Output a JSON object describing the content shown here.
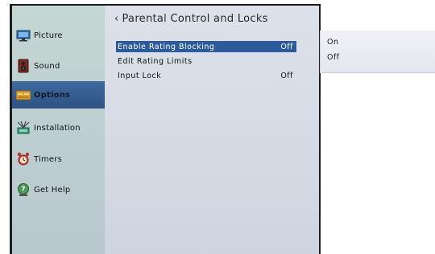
{
  "sidebar": {
    "items": [
      {
        "label": "Picture",
        "icon": "tv-icon"
      },
      {
        "label": "Sound",
        "icon": "speaker-icon"
      },
      {
        "label": "Options",
        "icon": "options-icon"
      },
      {
        "label": "Installation",
        "icon": "antenna-icon"
      },
      {
        "label": "Timers",
        "icon": "alarm-clock-icon"
      },
      {
        "label": "Get Help",
        "icon": "help-icon"
      }
    ],
    "active_index": 2
  },
  "main": {
    "back_glyph": "‹",
    "title": "Parental Control and Locks",
    "rows": [
      {
        "label": "Enable Rating Blocking",
        "value": "Off"
      },
      {
        "label": "Edit Rating Limits",
        "value": ""
      },
      {
        "label": "Input Lock",
        "value": "Off"
      }
    ],
    "selected_row": 0
  },
  "popup": {
    "options": [
      "On",
      "Off"
    ]
  },
  "colors": {
    "selection": "#2b5a9d",
    "active_nav": "#2e5283",
    "sidebar_bg": "#c4d7d3",
    "main_bg": "#d8dde6"
  }
}
